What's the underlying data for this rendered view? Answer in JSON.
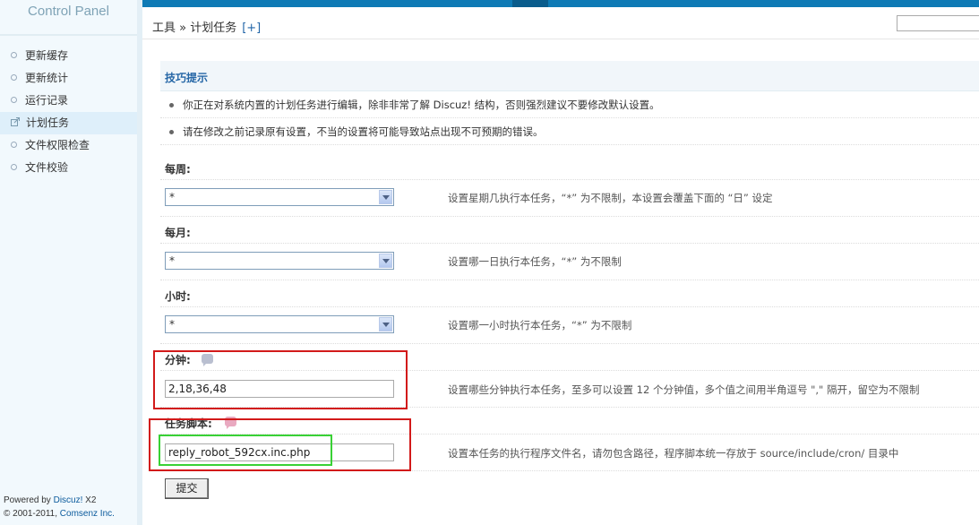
{
  "sidebar": {
    "logo": "Control Panel",
    "items": [
      {
        "label": "更新缓存",
        "active": false
      },
      {
        "label": "更新统计",
        "active": false
      },
      {
        "label": "运行记录",
        "active": false
      },
      {
        "label": "计划任务",
        "active": true
      },
      {
        "label": "文件权限检查",
        "active": false
      },
      {
        "label": "文件校验",
        "active": false
      }
    ],
    "powered_prefix": "Powered by ",
    "powered_link": "Discuz!",
    "powered_version": " X2",
    "copyright_prefix": "© 2001-2011, ",
    "copyright_link": "Comsenz Inc."
  },
  "header": {
    "breadcrumb": "工具 » 计划任务",
    "add_label": "[+]"
  },
  "tips": {
    "title": "技巧提示",
    "items": [
      "你正在对系统内置的计划任务进行编辑，除非非常了解 Discuz! 结构，否则强烈建议不要修改默认设置。",
      "请在修改之前记录原有设置，不当的设置将可能导致站点出现不可预期的错误。"
    ]
  },
  "form": {
    "weekday": {
      "label": "每周:",
      "value": "*",
      "hint": "设置星期几执行本任务，“*” 为不限制，本设置会覆盖下面的 “日” 设定"
    },
    "day": {
      "label": "每月:",
      "value": "*",
      "hint": "设置哪一日执行本任务，“*” 为不限制"
    },
    "hour": {
      "label": "小时:",
      "value": "*",
      "hint": "设置哪一小时执行本任务，“*” 为不限制"
    },
    "minute": {
      "label": "分钟:",
      "value": "2,18,36,48",
      "hint": "设置哪些分钟执行本任务，至多可以设置 12 个分钟值，多个值之间用半角逗号 \",\" 隔开，留空为不限制"
    },
    "script": {
      "label": "任务脚本:",
      "value": "reply_robot_592cx.inc.php",
      "hint": "设置本任务的执行程序文件名，请勿包含路径，程序脚本统一存放于 source/include/cron/ 目录中"
    },
    "submit_label": "提交"
  },
  "colors": {
    "topbar": "#0e7ab5",
    "link": "#2366a8",
    "highlight_red": "#d21a1a",
    "highlight_green": "#39d135"
  }
}
